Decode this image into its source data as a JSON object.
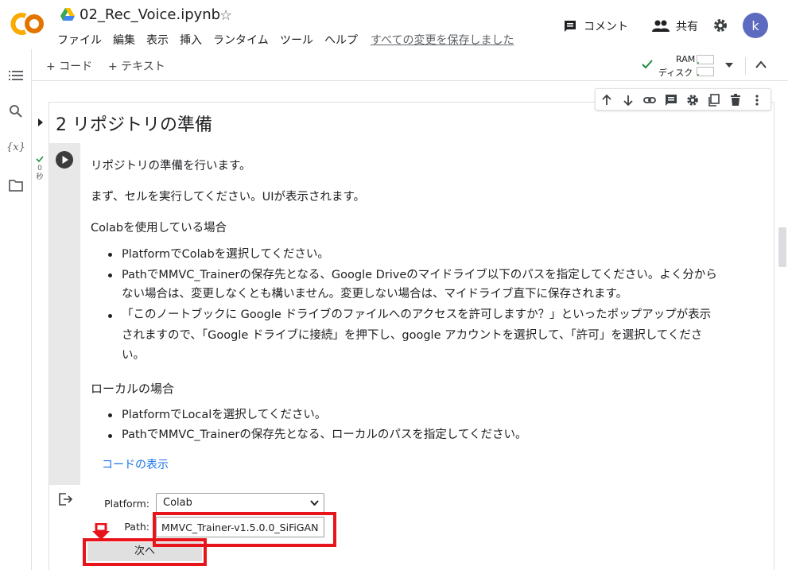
{
  "app": {
    "logo_text": "CO",
    "notebook_title": "02_Rec_Voice.ipynb",
    "menu": [
      "ファイル",
      "編集",
      "表示",
      "挿入",
      "ランタイム",
      "ツール",
      "ヘルプ"
    ],
    "save_status": "すべての変更を保存しました",
    "comment_label": "コメント",
    "share_label": "共有",
    "avatar_letter": "k"
  },
  "toolbar": {
    "add_code": "+ コード",
    "add_text": "+ テキスト",
    "ram_label": "RAM",
    "disk_label": "ディスク",
    "ram_usage": 0.1,
    "disk_usage": 0.1
  },
  "section": {
    "title": "2 リポジトリの準備",
    "exec_time": "0\n秒"
  },
  "markdown": {
    "p1": "リポジトリの準備を行います。",
    "p2": "まず、セルを実行してください。UIが表示されます。",
    "colab_heading": "Colabを使用している場合",
    "colab_bullets": [
      [
        "PlatformでColabを選択してください。"
      ],
      [
        "PathでMMVC_Trainerの保存先となる、Google Driveのマイドライブ以下のパスを指定してください。よく分から",
        "ない場合は、変更しなくとも構いません。変更しない場合は、マイドライブ直下に保存されます。"
      ],
      [
        "「このノートブックに Google ドライブのファイルへのアクセスを許可しますか？」といったポップアップが表示",
        "されますので、「Google ドライブに接続」を押下し、google アカウントを選択して、「許可」を選択してくださ",
        "い。"
      ]
    ],
    "local_heading": "ローカルの場合",
    "local_bullets": [
      [
        "PlatformでLocalを選択してください。"
      ],
      [
        "PathでMMVC_Trainerの保存先となる、ローカルのパスを指定してください。"
      ]
    ],
    "show_code": "コードの表示"
  },
  "form": {
    "platform_label": "Platform:",
    "platform_value": "Colab",
    "path_label": "Path:",
    "path_value": "MMVC_Trainer-v1.5.0.0_SiFiGAN",
    "next_button": "次へ"
  },
  "colors": {
    "highlight": "#e8141b",
    "link": "#1a73e8",
    "avatar": "#5c6bc0",
    "logo": "#f9ab00"
  }
}
